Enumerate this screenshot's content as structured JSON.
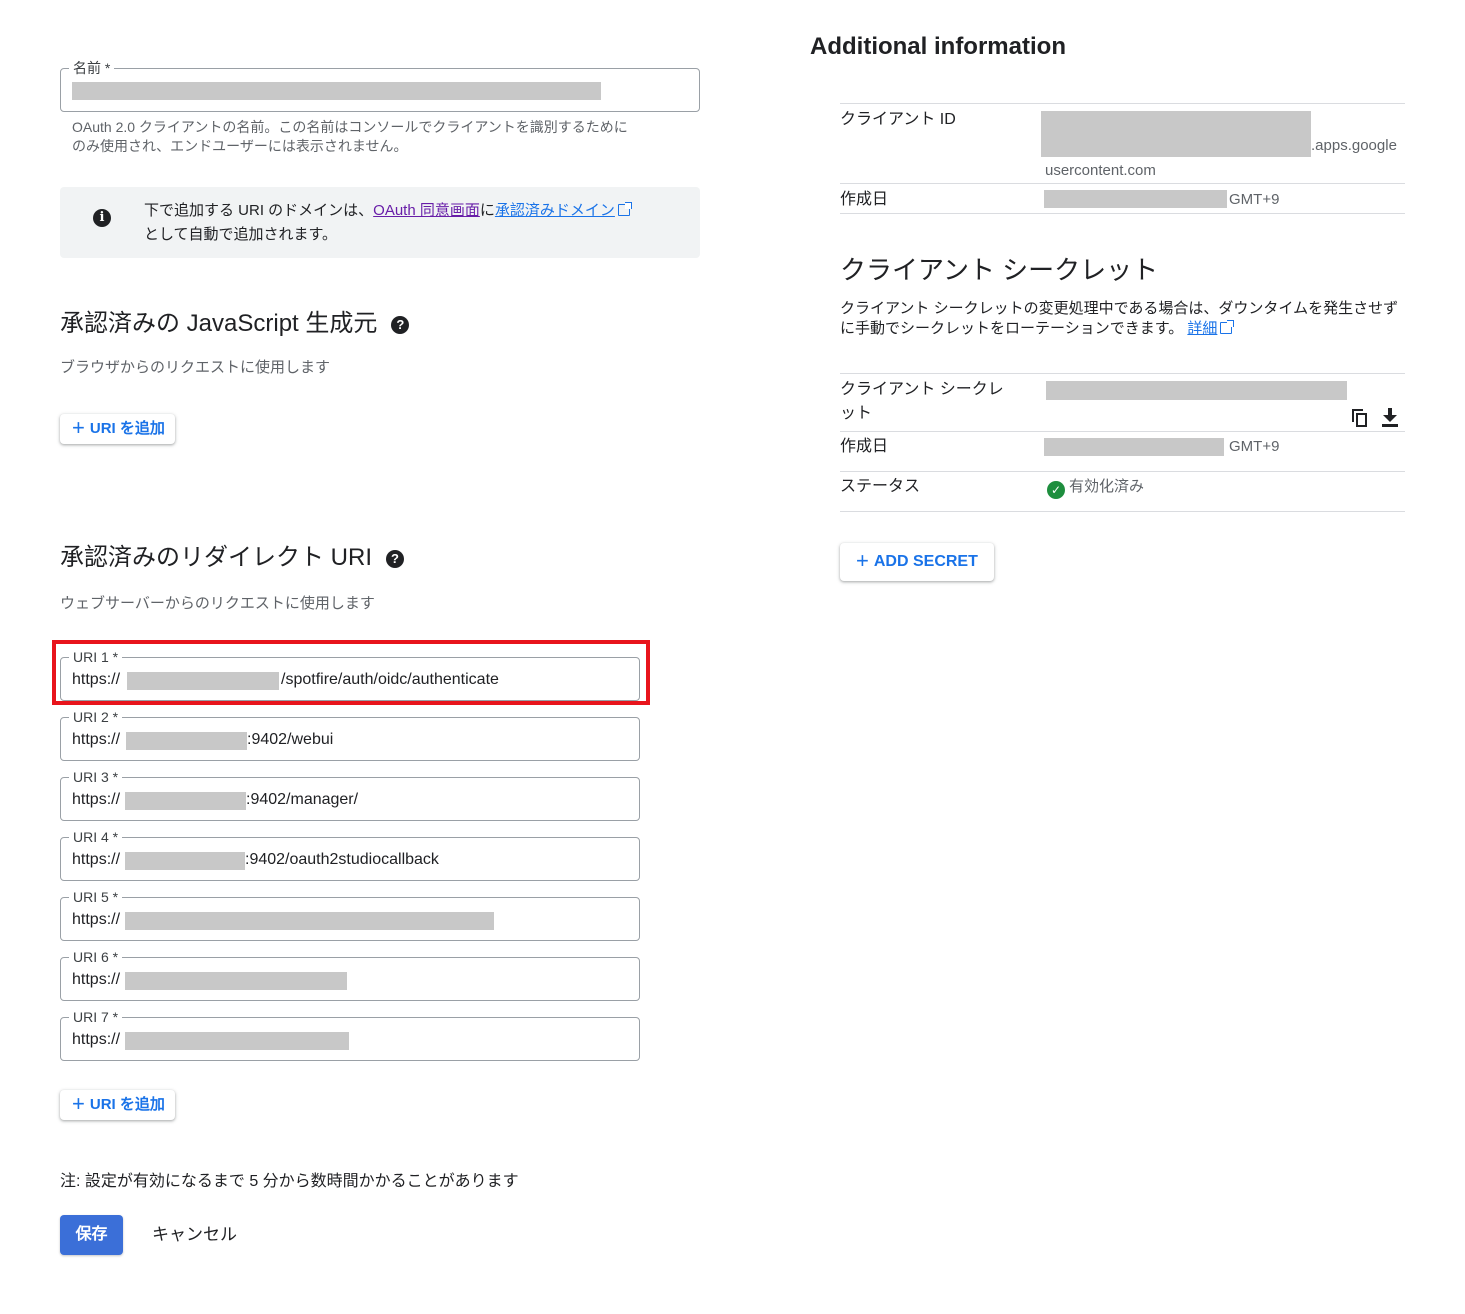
{
  "name_field": {
    "label": "名前 *",
    "hint_line1": "OAuth 2.0 クライアントの名前。この名前はコンソールでクライアントを識別するために",
    "hint_line2": "のみ使用され、エンドユーザーには表示されません。"
  },
  "info": {
    "icon": "info-icon",
    "text_before": "下で追加する URI のドメインは、",
    "link1": "OAuth 同意画面",
    "text_mid": "に",
    "link2": "承認済みドメイン",
    "text_after": "として自動で追加されます。"
  },
  "js_origins": {
    "title": "承認済みの JavaScript 生成元",
    "subtitle": "ブラウザからのリクエストに使用します",
    "add_button": "URI を追加"
  },
  "redirect_uris": {
    "title": "承認済みのリダイレクト URI",
    "subtitle": "ウェブサーバーからのリクエストに使用します",
    "add_button": "URI を追加",
    "items": [
      {
        "label": "URI 1 *",
        "prefix": "https://",
        "suffix": "/spotfire/auth/oidc/authenticate"
      },
      {
        "label": "URI 2 *",
        "prefix": "https://",
        "suffix": ":9402/webui"
      },
      {
        "label": "URI 3 *",
        "prefix": "https://",
        "suffix": ":9402/manager/"
      },
      {
        "label": "URI 4 *",
        "prefix": "https://",
        "suffix": ":9402/oauth2studiocallback"
      },
      {
        "label": "URI 5 *",
        "prefix": "https://",
        "suffix": ""
      },
      {
        "label": "URI 6 *",
        "prefix": "https://",
        "suffix": ""
      },
      {
        "label": "URI 7 *",
        "prefix": "https://",
        "suffix": ""
      }
    ]
  },
  "note": "注: 設定が有効になるまで 5 分から数時間かかることがあります",
  "actions": {
    "save": "保存",
    "cancel": "キャンセル"
  },
  "additional": {
    "title": "Additional information",
    "client_id_label": "クライアント ID",
    "client_id_suffix1": ".apps.google",
    "client_id_suffix2": "usercontent.com",
    "created_label": "作成日",
    "created_tz": "GMT+9"
  },
  "secret": {
    "title": "クライアント シークレット",
    "desc_line1": "クライアント シークレットの変更処理中である場合は、ダウンタイムを発生させず",
    "desc_line2": "に手動でシークレットをローテーションできます。",
    "details_link": "詳細",
    "secret_label_line1": "クライアント シークレ",
    "secret_label_line2": "ット",
    "created_label": "作成日",
    "created_tz": "GMT+9",
    "status_label": "ステータス",
    "status_value": "有効化済み",
    "add_secret": "ADD SECRET"
  },
  "colors": {
    "accent": "#1a73e8",
    "primary_button": "#3b6fd8",
    "highlight": "#e8141c",
    "status_ok": "#1e8e3e"
  }
}
